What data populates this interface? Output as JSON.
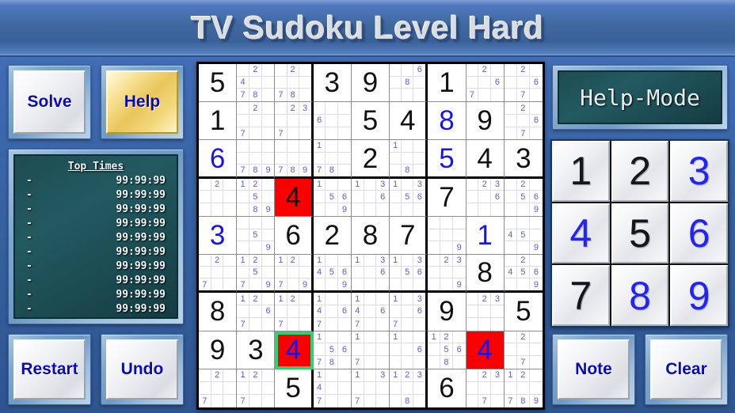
{
  "title": "TV Sudoku Level Hard",
  "buttons": {
    "solve": "Solve",
    "help": "Help",
    "restart": "Restart",
    "undo": "Undo",
    "note": "Note",
    "clear": "Clear",
    "help_mode": "Help-Mode"
  },
  "top_times": {
    "heading": "Top Times",
    "entries": [
      {
        "name": "-",
        "time": "99:99:99"
      },
      {
        "name": "-",
        "time": "99:99:99"
      },
      {
        "name": "-",
        "time": "99:99:99"
      },
      {
        "name": "-",
        "time": "99:99:99"
      },
      {
        "name": "-",
        "time": "99:99:99"
      },
      {
        "name": "-",
        "time": "99:99:99"
      },
      {
        "name": "-",
        "time": "99:99:99"
      },
      {
        "name": "-",
        "time": "99:99:99"
      },
      {
        "name": "-",
        "time": "99:99:99"
      },
      {
        "name": "-",
        "time": "99:99:99"
      }
    ]
  },
  "numpad": {
    "keys": [
      {
        "label": "1",
        "color": "black"
      },
      {
        "label": "2",
        "color": "black"
      },
      {
        "label": "3",
        "color": "blue"
      },
      {
        "label": "4",
        "color": "blue"
      },
      {
        "label": "5",
        "color": "black"
      },
      {
        "label": "6",
        "color": "blue"
      },
      {
        "label": "7",
        "color": "black"
      },
      {
        "label": "8",
        "color": "blue"
      },
      {
        "label": "9",
        "color": "blue"
      }
    ]
  },
  "colors": {
    "accent_blue": "#2323f4",
    "highlight_red": "#fb0000",
    "selection_green": "#2ad46e",
    "given_black": "#111111",
    "note_blue": "#5b5be4",
    "panel_dark": "#1d4d52",
    "title_text": "#d9dde2"
  },
  "board": {
    "rows": [
      [
        {
          "value": "5",
          "kind": "given"
        },
        {
          "notes": [
            null,
            "2",
            null,
            "4",
            null,
            null,
            "7",
            "8",
            null
          ]
        },
        {
          "notes": [
            null,
            "2",
            null,
            null,
            null,
            null,
            "7",
            "8",
            null
          ]
        },
        {
          "value": "3",
          "kind": "given"
        },
        {
          "value": "9",
          "kind": "given"
        },
        {
          "notes": [
            null,
            null,
            "6",
            null,
            "8",
            null,
            null,
            null,
            null
          ]
        },
        {
          "value": "1",
          "kind": "given"
        },
        {
          "notes": [
            null,
            "2",
            null,
            null,
            null,
            "6",
            "7",
            null,
            null
          ]
        },
        {
          "notes": [
            null,
            "2",
            null,
            null,
            null,
            "6",
            null,
            "7",
            null
          ]
        }
      ],
      [
        {
          "value": "1",
          "kind": "given"
        },
        {
          "notes": [
            null,
            "2",
            null,
            null,
            null,
            null,
            "7",
            null,
            null
          ]
        },
        {
          "notes": [
            null,
            "2",
            "3",
            null,
            null,
            null,
            "7",
            null,
            null
          ]
        },
        {
          "notes": [
            null,
            null,
            null,
            "6",
            null,
            null,
            null,
            null,
            null
          ]
        },
        {
          "value": "5",
          "kind": "given"
        },
        {
          "value": "4",
          "kind": "given"
        },
        {
          "value": "8",
          "kind": "user"
        },
        {
          "value": "9",
          "kind": "given"
        },
        {
          "notes": [
            null,
            "2",
            null,
            null,
            null,
            "6",
            null,
            "7",
            null
          ]
        }
      ],
      [
        {
          "value": "6",
          "kind": "user"
        },
        {
          "notes": [
            null,
            null,
            null,
            null,
            null,
            null,
            "7",
            "8",
            "9"
          ]
        },
        {
          "notes": [
            null,
            null,
            null,
            null,
            null,
            null,
            "7",
            "8",
            "9"
          ]
        },
        {
          "notes": [
            "1",
            null,
            null,
            null,
            null,
            null,
            "7",
            "8",
            null
          ]
        },
        {
          "value": "2",
          "kind": "given"
        },
        {
          "notes": [
            "1",
            null,
            null,
            null,
            null,
            null,
            null,
            "8",
            null
          ]
        },
        {
          "value": "5",
          "kind": "user"
        },
        {
          "value": "4",
          "kind": "given"
        },
        {
          "value": "3",
          "kind": "given"
        }
      ],
      [
        {
          "notes": [
            null,
            "2",
            null,
            null,
            null,
            null,
            null,
            null,
            null
          ]
        },
        {
          "notes": [
            "1",
            "2",
            null,
            null,
            "5",
            null,
            null,
            "8",
            "9"
          ]
        },
        {
          "value": "4",
          "kind": "given",
          "highlight": true
        },
        {
          "notes": [
            "1",
            null,
            null,
            null,
            "5",
            "6",
            null,
            null,
            "9"
          ]
        },
        {
          "notes": [
            "1",
            null,
            "3",
            null,
            null,
            "6",
            null,
            null,
            null
          ]
        },
        {
          "notes": [
            "1",
            null,
            "3",
            null,
            "5",
            "6",
            null,
            null,
            null
          ]
        },
        {
          "value": "7",
          "kind": "given"
        },
        {
          "notes": [
            null,
            "2",
            "3",
            null,
            null,
            "6",
            null,
            null,
            null
          ]
        },
        {
          "notes": [
            null,
            "2",
            null,
            null,
            "5",
            "6",
            null,
            null,
            "9"
          ]
        }
      ],
      [
        {
          "value": "3",
          "kind": "user"
        },
        {
          "notes": [
            null,
            null,
            null,
            null,
            "5",
            null,
            null,
            null,
            "9"
          ]
        },
        {
          "value": "6",
          "kind": "given"
        },
        {
          "value": "2",
          "kind": "given"
        },
        {
          "value": "8",
          "kind": "given"
        },
        {
          "value": "7",
          "kind": "given"
        },
        {
          "notes": [
            null,
            null,
            null,
            null,
            null,
            null,
            null,
            null,
            "9"
          ]
        },
        {
          "value": "1",
          "kind": "user"
        },
        {
          "notes": [
            null,
            null,
            null,
            "4",
            "5",
            null,
            null,
            null,
            "9"
          ]
        }
      ],
      [
        {
          "notes": [
            null,
            "2",
            null,
            null,
            null,
            null,
            "7",
            null,
            null
          ]
        },
        {
          "notes": [
            "1",
            "2",
            null,
            null,
            "5",
            null,
            "7",
            null,
            "9"
          ]
        },
        {
          "notes": [
            "1",
            "2",
            null,
            null,
            null,
            null,
            "7",
            null,
            "9"
          ]
        },
        {
          "notes": [
            "1",
            null,
            null,
            "4",
            "5",
            "6",
            null,
            null,
            "9"
          ]
        },
        {
          "notes": [
            "1",
            null,
            "3",
            null,
            null,
            "6",
            null,
            null,
            null
          ]
        },
        {
          "notes": [
            "1",
            null,
            "3",
            null,
            "5",
            "6",
            null,
            null,
            null
          ]
        },
        {
          "notes": [
            null,
            "2",
            "3",
            null,
            null,
            null,
            null,
            null,
            "9"
          ]
        },
        {
          "value": "8",
          "kind": "given"
        },
        {
          "notes": [
            null,
            "2",
            null,
            "4",
            "5",
            "6",
            null,
            null,
            "9"
          ]
        }
      ],
      [
        {
          "value": "8",
          "kind": "given"
        },
        {
          "notes": [
            "1",
            "2",
            null,
            null,
            null,
            "6",
            "7",
            null,
            null
          ]
        },
        {
          "notes": [
            "1",
            "2",
            null,
            null,
            null,
            null,
            "7",
            null,
            null
          ]
        },
        {
          "notes": [
            "1",
            null,
            null,
            "4",
            null,
            "6",
            "7",
            null,
            null
          ]
        },
        {
          "notes": [
            "1",
            null,
            null,
            "4",
            null,
            "6",
            "7",
            null,
            null
          ]
        },
        {
          "notes": [
            "1",
            null,
            "3",
            null,
            null,
            "6",
            "7",
            null,
            null
          ]
        },
        {
          "value": "9",
          "kind": "given"
        },
        {
          "notes": [
            null,
            "2",
            "3",
            null,
            null,
            null,
            null,
            null,
            null
          ]
        },
        {
          "value": "5",
          "kind": "given"
        }
      ],
      [
        {
          "value": "9",
          "kind": "given"
        },
        {
          "value": "3",
          "kind": "given"
        },
        {
          "value": "4",
          "kind": "user",
          "highlight": true,
          "selected": true
        },
        {
          "notes": [
            "1",
            null,
            null,
            null,
            "5",
            "6",
            "7",
            "8",
            null
          ]
        },
        {
          "notes": [
            "1",
            null,
            null,
            null,
            null,
            null,
            "7",
            null,
            null
          ]
        },
        {
          "notes": [
            "1",
            null,
            null,
            null,
            null,
            "6",
            null,
            null,
            null
          ]
        },
        {
          "notes": [
            "1",
            "2",
            null,
            null,
            "5",
            "6",
            null,
            "8",
            null
          ]
        },
        {
          "value": "4",
          "kind": "user",
          "highlight": true
        },
        {
          "notes": [
            null,
            "2",
            null,
            null,
            null,
            null,
            null,
            "7",
            null
          ]
        }
      ],
      [
        {
          "notes": [
            null,
            "2",
            null,
            null,
            null,
            null,
            "7",
            null,
            null
          ]
        },
        {
          "notes": [
            "1",
            "2",
            null,
            null,
            null,
            null,
            "7",
            null,
            null
          ]
        },
        {
          "value": "5",
          "kind": "given"
        },
        {
          "notes": [
            "1",
            null,
            null,
            "4",
            null,
            null,
            "7",
            null,
            null
          ]
        },
        {
          "notes": [
            "1",
            null,
            "3",
            null,
            null,
            null,
            "7",
            null,
            null
          ]
        },
        {
          "notes": [
            "1",
            "2",
            "3",
            null,
            null,
            null,
            null,
            "8",
            null
          ]
        },
        {
          "value": "6",
          "kind": "given"
        },
        {
          "notes": [
            null,
            "2",
            "3",
            null,
            null,
            null,
            null,
            "7",
            null
          ]
        },
        {
          "notes": [
            "1",
            "2",
            null,
            null,
            null,
            null,
            "7",
            "8",
            "9"
          ]
        }
      ]
    ]
  }
}
